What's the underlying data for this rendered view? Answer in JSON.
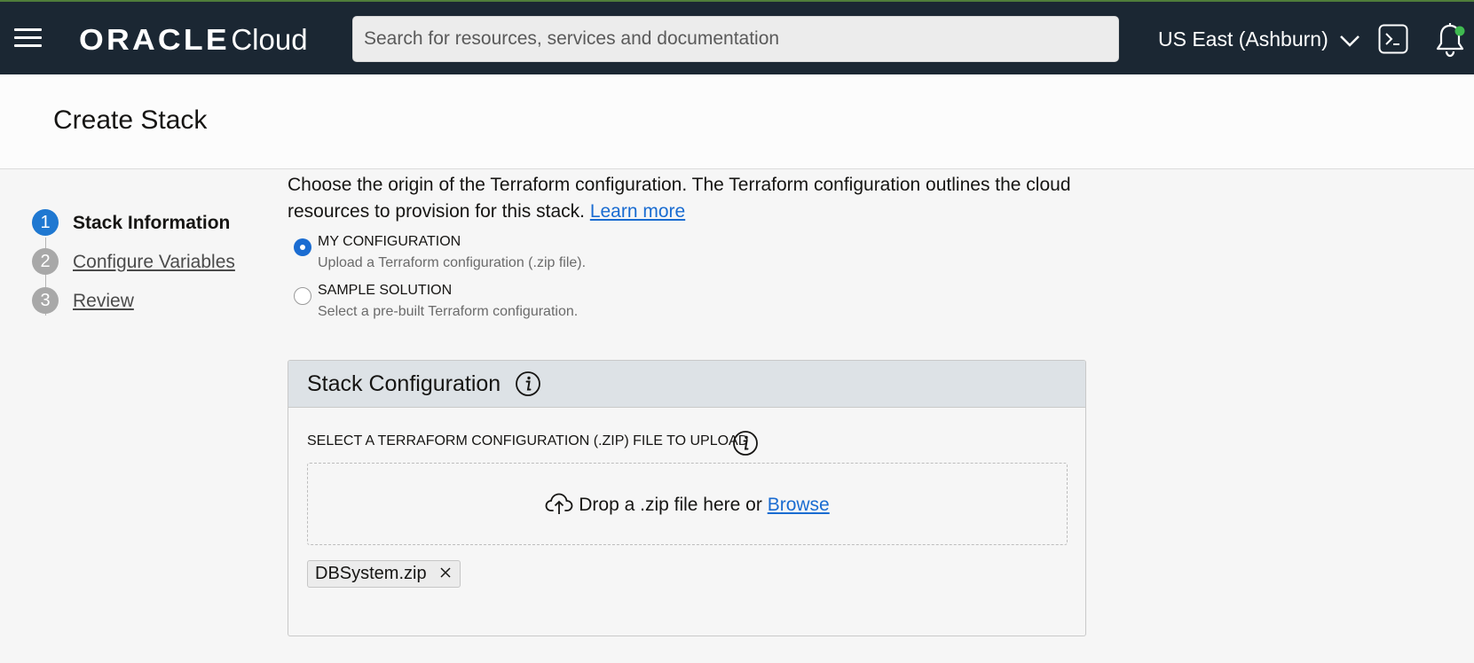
{
  "header": {
    "menu_icon": "hamburger-menu-icon",
    "logo_brand": "ORACLE",
    "logo_product": "Cloud",
    "search_placeholder": "Search for resources, services and documentation",
    "region": "US East (Ashburn)",
    "region_icon": "chevron-down-icon",
    "shell_icon": "cloud-shell-icon",
    "notifications_icon": "bell-icon",
    "notification_dot_color": "#3fb950",
    "bar_color": "#1b2733"
  },
  "page": {
    "title": "Create Stack"
  },
  "steps": [
    {
      "number": "1",
      "label": "Stack Information",
      "active": true
    },
    {
      "number": "2",
      "label": "Configure Variables",
      "active": false
    },
    {
      "number": "3",
      "label": "Review",
      "active": false
    }
  ],
  "origin": {
    "description": "Choose the origin of the Terraform configuration. The Terraform configuration outlines the cloud resources to provision for this stack.",
    "learn_more": "Learn more",
    "options": [
      {
        "title": "MY CONFIGURATION",
        "description": "Upload a Terraform configuration (.zip file).",
        "selected": true
      },
      {
        "title": "SAMPLE SOLUTION",
        "description": "Select a pre-built Terraform configuration.",
        "selected": false
      }
    ]
  },
  "stack_config": {
    "title": "Stack Configuration",
    "upload_label": "SELECT A TERRAFORM CONFIGURATION (.ZIP) FILE TO UPLOAD",
    "drop_text": "Drop a .zip file here or",
    "browse": "Browse",
    "upload_icon": "cloud-upload-icon",
    "uploaded_file": "DBSystem.zip"
  },
  "colors": {
    "accent": "#1a6cd1",
    "step_active": "#1f78d1",
    "step_inactive": "#a8a8a8"
  }
}
